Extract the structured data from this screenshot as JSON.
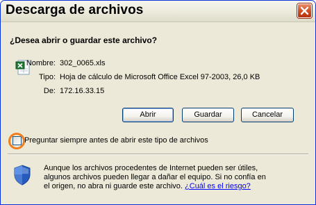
{
  "window": {
    "title": "Descarga de archivos"
  },
  "dialog": {
    "question": "¿Desea abrir o guardar este archivo?",
    "file": {
      "name_label": "Nombre:",
      "name_value": "302_0065.xls",
      "type_label": "Tipo:",
      "type_value": "Hoja de cálculo de Microsoft Office Excel 97-2003, 26,0 KB",
      "from_label": "De:",
      "from_value": "172.16.33.15"
    },
    "buttons": {
      "open": "Abrir",
      "save": "Guardar",
      "cancel": "Cancelar"
    },
    "checkbox": {
      "label": "Preguntar siempre antes de abrir este tipo de archivos",
      "checked": false
    },
    "warning": {
      "line1": "Aunque los archivos procedentes de Internet pueden ser útiles,",
      "line2": "algunos archivos pueden llegar a dañar el equipo. Si no confía en",
      "line3": "el origen, no abra ni guarde este archivo.",
      "link": "¿Cuál es el riesgo?"
    }
  },
  "icons": {
    "close": "close-icon",
    "file": "excel-file-icon",
    "shield": "shield-icon"
  },
  "colors": {
    "highlight_ring": "#f07e1e",
    "link": "#0000ff",
    "close_button": "#d24e24"
  }
}
